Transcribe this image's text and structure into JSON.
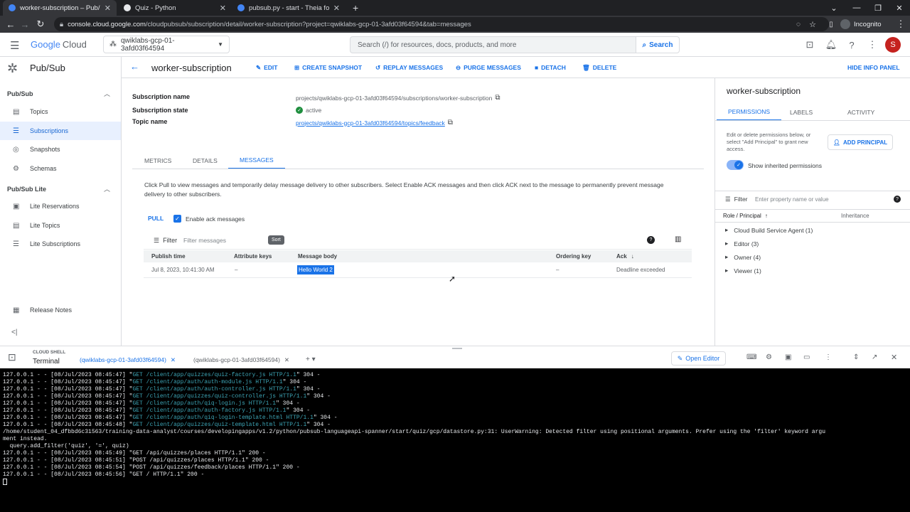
{
  "browser": {
    "tabs": [
      {
        "title": "worker-subscription – Pub/Sub – …",
        "favicon_color": "#4285f4"
      },
      {
        "title": "Quiz - Python",
        "favicon_color": "#e8eaed"
      },
      {
        "title": "pubsub.py - start - Theia for Clo…",
        "favicon_color": "#4285f4"
      }
    ],
    "url_domain": "console.cloud.google.com",
    "url_path": "/cloudpubsub/subscription/detail/worker-subscription?project=qwiklabs-gcp-01-3afd03f64594&tab=messages",
    "incognito_label": "Incognito"
  },
  "header": {
    "logo_google": "Google",
    "logo_cloud": "Cloud",
    "project": "qwiklabs-gcp-01-3afd03f64594",
    "search_placeholder": "Search (/) for resources, docs, products, and more",
    "search_button": "Search",
    "avatar_letter": "S"
  },
  "sidebar": {
    "product": "Pub/Sub",
    "section1": "Pub/Sub",
    "items1": [
      "Topics",
      "Subscriptions",
      "Snapshots",
      "Schemas"
    ],
    "section2": "Pub/Sub Lite",
    "items2": [
      "Lite Reservations",
      "Lite Topics",
      "Lite Subscriptions"
    ],
    "release_notes": "Release Notes"
  },
  "toolbar": {
    "title": "worker-subscription",
    "edit": "EDIT",
    "create_snapshot": "CREATE SNAPSHOT",
    "replay": "REPLAY MESSAGES",
    "purge": "PURGE MESSAGES",
    "detach": "DETACH",
    "delete": "DELETE",
    "hide_info": "HIDE INFO PANEL"
  },
  "details": {
    "name_label": "Subscription name",
    "name_value": "projects/qwiklabs-gcp-01-3afd03f64594/subscriptions/worker-subscription",
    "state_label": "Subscription state",
    "state_value": "active",
    "topic_label": "Topic name",
    "topic_value": "projects/qwiklabs-gcp-01-3afd03f64594/topics/feedback"
  },
  "tabs": [
    "METRICS",
    "DETAILS",
    "MESSAGES"
  ],
  "messages": {
    "info": "Click Pull to view messages and temporarily delay message delivery to other subscribers. Select Enable ACK messages and then click ACK next to the message to permanently prevent message delivery to other subscribers.",
    "pull": "PULL",
    "enable_ack": "Enable ack messages",
    "filter_label": "Filter",
    "filter_placeholder": "Filter messages",
    "sort_tooltip": "Sort",
    "columns": [
      "Publish time",
      "Attribute keys",
      "Message body",
      "Ordering key",
      "Ack"
    ],
    "rows": [
      {
        "time": "Jul 8, 2023, 10:41:30 AM",
        "attrs": "–",
        "body": "Hello World 2",
        "order": "–",
        "ack": "Deadline exceeded"
      }
    ]
  },
  "info_panel": {
    "title": "worker-subscription",
    "tabs": [
      "PERMISSIONS",
      "LABELS",
      "ACTIVITY"
    ],
    "desc": "Edit or delete permissions below, or select \"Add Principal\" to grant new access.",
    "add_principal": "ADD PRINCIPAL",
    "show_inherited": "Show inherited permissions",
    "filter_label": "Filter",
    "filter_placeholder": "Enter property name or value",
    "col_role": "Role / Principal",
    "col_inherit": "Inheritance",
    "roles": [
      "Cloud Build Service Agent (1)",
      "Editor (3)",
      "Owner (4)",
      "Viewer (1)"
    ]
  },
  "shell": {
    "label": "CLOUD SHELL",
    "terminal": "Terminal",
    "tab1": "(qwiklabs-gcp-01-3afd03f64594)",
    "tab2": "(qwiklabs-gcp-01-3afd03f64594)",
    "open_editor": "Open Editor"
  },
  "terminal_lines": [
    {
      "pre": "127.0.0.1 - - [08/Jul/2023 08:45:47] \"",
      "req": "GET /client/app/quizzes/quiz-factory.js HTTP/1.1",
      "post": "\" 304 -"
    },
    {
      "pre": "127.0.0.1 - - [08/Jul/2023 08:45:47] \"",
      "req": "GET /client/app/auth/auth-module.js HTTP/1.1",
      "post": "\" 304 -"
    },
    {
      "pre": "127.0.0.1 - - [08/Jul/2023 08:45:47] \"",
      "req": "GET /client/app/auth/auth-controller.js HTTP/1.1",
      "post": "\" 304 -"
    },
    {
      "pre": "127.0.0.1 - - [08/Jul/2023 08:45:47] \"",
      "req": "GET /client/app/quizzes/quiz-controller.js HTTP/1.1",
      "post": "\" 304 -"
    },
    {
      "pre": "127.0.0.1 - - [08/Jul/2023 08:45:47] \"",
      "req": "GET /client/app/auth/qiq-login.js HTTP/1.1",
      "post": "\" 304 -"
    },
    {
      "pre": "127.0.0.1 - - [08/Jul/2023 08:45:47] \"",
      "req": "GET /client/app/auth/auth-factory.js HTTP/1.1",
      "post": "\" 304 -"
    },
    {
      "pre": "127.0.0.1 - - [08/Jul/2023 08:45:47] \"",
      "req": "GET /client/app/auth/qiq-login-template.html HTTP/1.1",
      "post": "\" 304 -"
    },
    {
      "pre": "127.0.0.1 - - [08/Jul/2023 08:45:48] \"",
      "req": "GET /client/app/quizzes/quiz-template.html HTTP/1.1",
      "post": "\" 304 -"
    },
    {
      "pre": "/home/student_04_dfbbd6c31563/training-data-analyst/courses/developingapps/v1.2/python/pubsub-languageapi-spanner/start/quiz/gcp/datastore.py:31: UserWarning: Detected filter using positional arguments. Prefer using the 'filter' keyword argu",
      "req": "",
      "post": ""
    },
    {
      "pre": "ment instead.",
      "req": "",
      "post": ""
    },
    {
      "pre": "  query.add_filter('quiz', '=', quiz)",
      "req": "",
      "post": ""
    },
    {
      "pre": "127.0.0.1 - - [08/Jul/2023 08:45:49] \"GET /api/quizzes/places HTTP/1.1\" 200 -",
      "req": "",
      "post": ""
    },
    {
      "pre": "127.0.0.1 - - [08/Jul/2023 08:45:51] \"POST /api/quizzes/places HTTP/1.1\" 200 -",
      "req": "",
      "post": ""
    },
    {
      "pre": "127.0.0.1 - - [08/Jul/2023 08:45:54] \"POST /api/quizzes/feedback/places HTTP/1.1\" 200 -",
      "req": "",
      "post": ""
    },
    {
      "pre": "127.0.0.1 - - [08/Jul/2023 08:45:56] \"GET / HTTP/1.1\" 200 -",
      "req": "",
      "post": ""
    }
  ]
}
